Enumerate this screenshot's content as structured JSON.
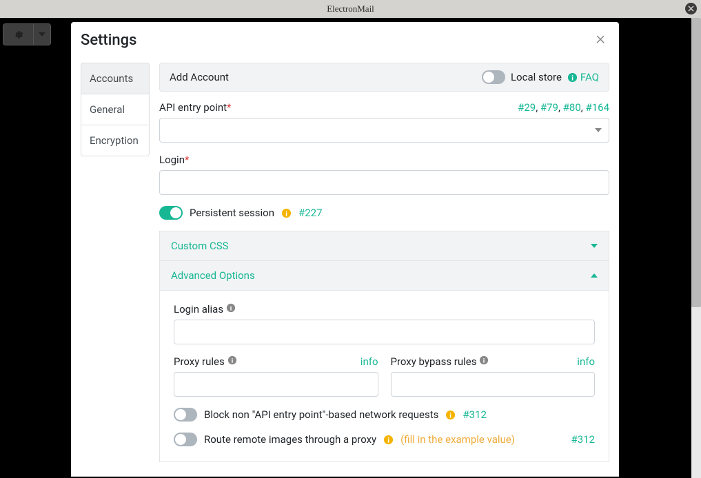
{
  "titlebar": {
    "title": "ElectronMail"
  },
  "modal": {
    "title": "Settings",
    "nav": {
      "items": [
        {
          "label": "Accounts"
        },
        {
          "label": "General"
        },
        {
          "label": "Encryption"
        }
      ]
    },
    "card": {
      "title": "Add Account",
      "local_store_label": "Local store",
      "faq_label": "FAQ"
    },
    "api": {
      "label": "API entry point",
      "links": [
        "#29",
        "#79",
        "#80",
        "#164"
      ]
    },
    "login": {
      "label": "Login"
    },
    "persistent": {
      "label": "Persistent session",
      "issue": "#227"
    },
    "accordion": {
      "custom_css": "Custom CSS",
      "advanced": "Advanced Options"
    },
    "advanced": {
      "login_alias": "Login alias",
      "proxy_rules": "Proxy rules",
      "proxy_bypass": "Proxy bypass rules",
      "info": "info",
      "block_non_api": "Block non \"API entry point\"-based network requests",
      "block_issue": "#312",
      "route_images": "Route remote images through a proxy",
      "route_hint": "(fill in the example value)",
      "route_issue": "#312"
    }
  }
}
